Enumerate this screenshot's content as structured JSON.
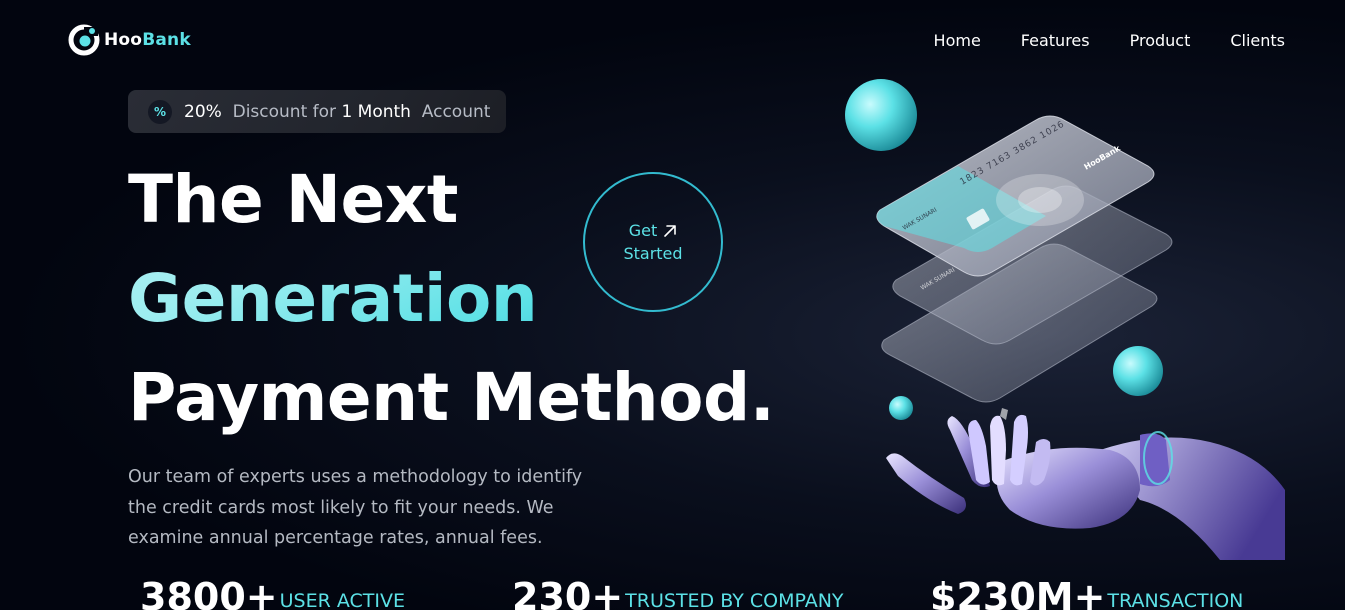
{
  "brand": {
    "name_part1": "Hoo",
    "name_part2": "Bank",
    "logo_icon": "hoobank-logo-icon",
    "accent_color": "#5ce1e6"
  },
  "nav": {
    "links": [
      {
        "label": "Home"
      },
      {
        "label": "Features"
      },
      {
        "label": "Product"
      },
      {
        "label": "Clients"
      }
    ]
  },
  "badge": {
    "icon": "discount-icon",
    "icon_glyph": "%",
    "percent": "20%",
    "text1": "Discount for",
    "highlight": "1 Month",
    "text2": "Account"
  },
  "hero": {
    "line1": "The Next",
    "line2": "Generation",
    "line3": "Payment Method.",
    "description": "Our team of experts uses a methodology to identify the credit cards most likely to fit your needs. We examine annual percentage rates, annual fees."
  },
  "cta": {
    "line1": "Get",
    "line2": "Started",
    "icon": "arrow-up-right-icon"
  },
  "card": {
    "number": "1823 7163 3862 1026",
    "brand": "HooBank",
    "holder": "WAK SUNARI"
  },
  "stats": [
    {
      "value": "3800+",
      "label": "USER ACTIVE"
    },
    {
      "value": "230+",
      "label": "TRUSTED BY COMPANY"
    },
    {
      "value": "$230M+",
      "label": "TRANSACTION"
    }
  ]
}
